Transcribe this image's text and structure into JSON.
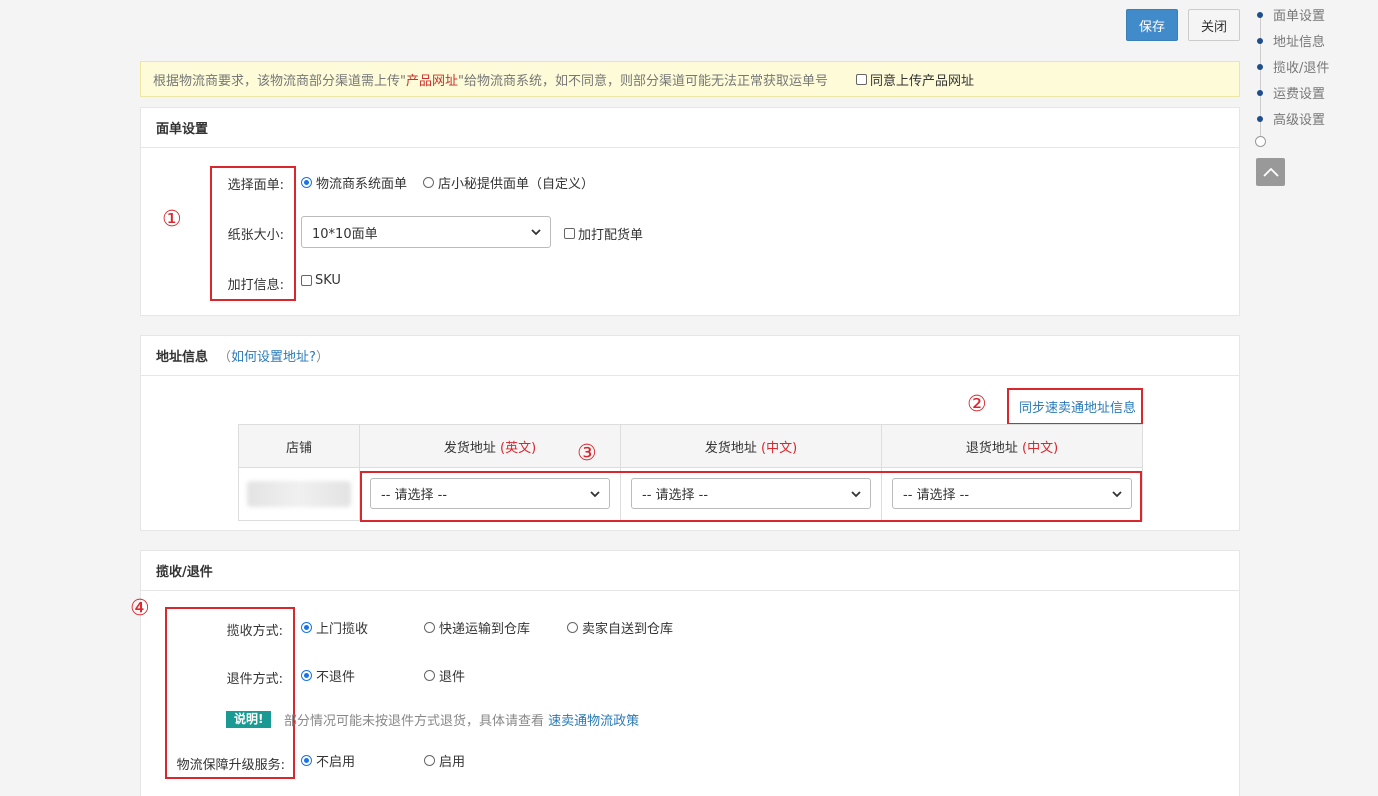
{
  "toolbar": {
    "save_label": "保存",
    "close_label": "关闭"
  },
  "notice": {
    "text_before": "根据物流商要求，该物流商部分渠道需上传\"",
    "highlight": "产品网址",
    "text_after": "\"给物流商系统，如不同意，则部分渠道可能无法正常获取运单号",
    "agree_label": "同意上传产品网址"
  },
  "section_label": {
    "title": "面单设置",
    "select_label": "选择面单:",
    "option_logistics": "物流商系统面单",
    "option_custom": "店小秘提供面单（自定义）",
    "paper_label": "纸张大小:",
    "paper_value": "10*10面单",
    "extra_pick_label": "加打配货单",
    "extra_info_label": "加打信息:",
    "sku_label": "SKU",
    "annotation": "①"
  },
  "section_address": {
    "title": "地址信息",
    "help_open": "（",
    "help_link": "如何设置地址?",
    "help_close": "）",
    "sync_link": "同步速卖通地址信息",
    "annotation_sync": "②",
    "annotation_selects": "③",
    "columns": {
      "shop": "店铺",
      "ship_en": "发货地址",
      "ship_en_tag": "(英文)",
      "ship_cn": "发货地址",
      "ship_cn_tag": "(中文)",
      "return_cn": "退货地址",
      "return_cn_tag": "(中文)"
    },
    "select_placeholder": "-- 请选择 --"
  },
  "section_pickup": {
    "title": "揽收/退件",
    "annotation": "④",
    "pickup_label": "揽收方式:",
    "pickup_options": [
      "上门揽收",
      "快递运输到仓库",
      "卖家自送到仓库"
    ],
    "return_label": "退件方式:",
    "return_options": [
      "不退件",
      "退件"
    ],
    "note_badge": "说明!",
    "note_text": "部分情况可能未按退件方式退货，具体请查看",
    "note_link": "速卖通物流政策",
    "service_label": "物流保障升级服务:",
    "service_options": [
      "不启用",
      "启用"
    ]
  },
  "side_nav": {
    "items": [
      "面单设置",
      "地址信息",
      "揽收/退件",
      "运费设置",
      "高级设置"
    ]
  },
  "colors": {
    "primary": "#428bca",
    "annotation_red": "#d9272e",
    "link": "#2a7ab8",
    "badge": "#1a9a93"
  }
}
